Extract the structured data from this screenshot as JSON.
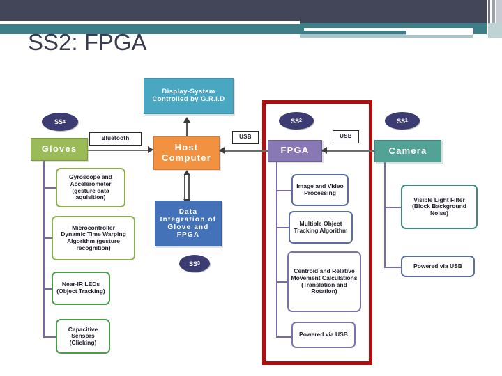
{
  "slide": {
    "title": "SS2: FPGA",
    "background": "#ffffff",
    "header_dark": "#434559",
    "header_teal": "#3E7E88",
    "highlight_frame_color": "#B40D0D"
  },
  "badges": {
    "ss4": {
      "label": "SS",
      "sub": "4"
    },
    "ss3": {
      "label": "SS",
      "sub": "3"
    },
    "ss2": {
      "label": "SS",
      "sub": "2"
    },
    "ss1": {
      "label": "SS",
      "sub": "1"
    }
  },
  "connection_labels": {
    "bluetooth": "Bluetooth",
    "usb_left": "USB",
    "usb_right": "USB"
  },
  "display_system": {
    "label": "Display-System Controlled by G.R.I.D",
    "color": "#4AA7C2"
  },
  "host_computer": {
    "label": "Host Computer",
    "color": "#F2913F"
  },
  "data_integration": {
    "label": "Data Integration of Glove and FPGA",
    "color": "#4472B8"
  },
  "gloves": {
    "label": "Gloves",
    "color": "#9BBB59",
    "border": "#7A9A3C",
    "children": [
      "Gyroscope and Accelerometer (gesture data aquisition)",
      "Microcontroller\nDynamic Time Warping Algorithm (gesture recognition)",
      "Near-IR LEDs (Object Tracking)",
      "Capacitive Sensors (Clicking)"
    ]
  },
  "fpga": {
    "label": "FPGA",
    "color": "#8878B4",
    "border": "#6E5F9A",
    "children": [
      "Image and Video Processing",
      "Multiple Object Tracking Algorithm",
      "Centroid and Relative Movement Calculations (Translation and Rotation)",
      "Powered via USB"
    ]
  },
  "camera": {
    "label": "Camera",
    "color": "#52A396",
    "border": "#3E8A7E",
    "children": [
      "Visible Light Filter (Block Background Noise)",
      "Powered via USB"
    ]
  }
}
